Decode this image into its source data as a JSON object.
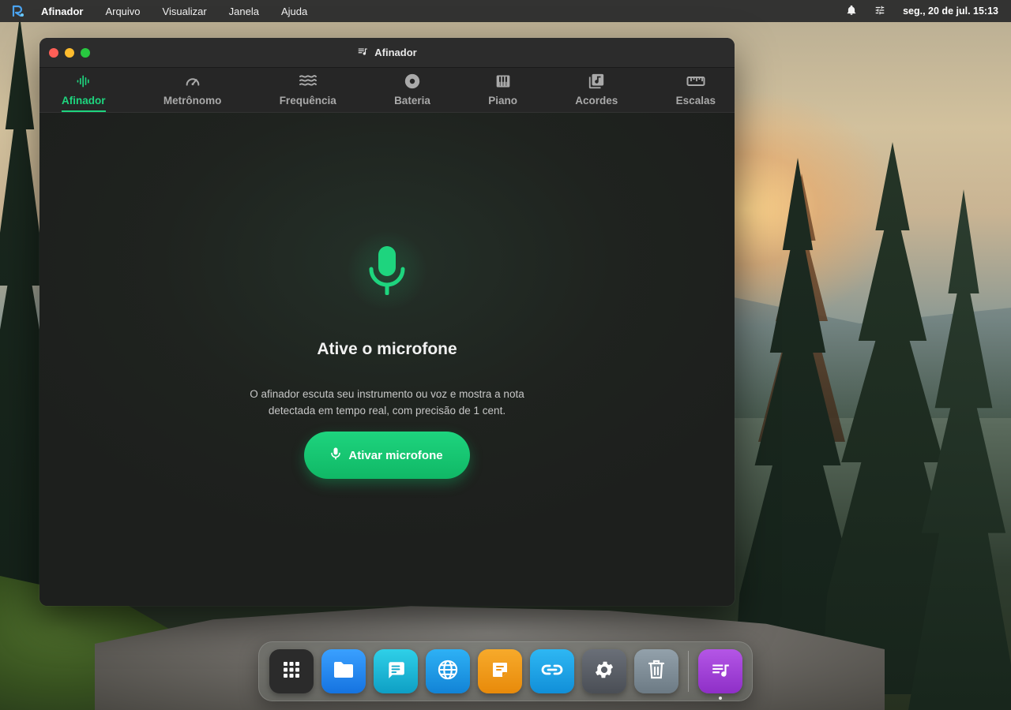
{
  "menubar": {
    "app_name": "Afinador",
    "menus": [
      "Arquivo",
      "Visualizar",
      "Janela",
      "Ajuda"
    ],
    "clock": "seg., 20 de jul. 15:13",
    "icons": [
      "app-logo-icon",
      "bell-icon",
      "sliders-icon"
    ]
  },
  "window": {
    "title": "Afinador",
    "tabs": [
      {
        "label": "Afinador",
        "icon": "waveform-icon",
        "active": true
      },
      {
        "label": "Metrônomo",
        "icon": "gauge-icon",
        "active": false
      },
      {
        "label": "Frequência",
        "icon": "waves-icon",
        "active": false
      },
      {
        "label": "Bateria",
        "icon": "disc-icon",
        "active": false
      },
      {
        "label": "Piano",
        "icon": "piano-icon",
        "active": false
      },
      {
        "label": "Acordes",
        "icon": "library-music-icon",
        "active": false
      },
      {
        "label": "Escalas",
        "icon": "ruler-icon",
        "active": false
      }
    ]
  },
  "main": {
    "heading": "Ative o microfone",
    "description": "O afinador escuta seu instrumento ou voz e mostra a nota detectada em tempo real, com precisão de 1 cent.",
    "button_label": "Ativar microfone"
  },
  "dock": {
    "items": [
      {
        "name": "launcher",
        "icon": "grid-icon",
        "color": "#2b2b2b"
      },
      {
        "name": "files",
        "icon": "folder-icon",
        "color": "#1f8ef1"
      },
      {
        "name": "messages",
        "icon": "chat-icon",
        "color": "#18b6d6"
      },
      {
        "name": "browser",
        "icon": "globe-icon",
        "color": "#1d9ce6"
      },
      {
        "name": "notes",
        "icon": "note-icon",
        "color": "#f29a13"
      },
      {
        "name": "links",
        "icon": "link-icon",
        "color": "#1aa6e8"
      },
      {
        "name": "settings",
        "icon": "gear-icon",
        "color": "#5b5f66"
      },
      {
        "name": "trash",
        "icon": "trash-icon",
        "color": "#7d8a94"
      },
      {
        "name": "afinador",
        "icon": "playlist-music-icon",
        "color": "#a33fd6",
        "running": true
      }
    ]
  },
  "colors": {
    "accent": "#1ed47e",
    "menubar": "#2e2e2e",
    "window_bg": "#1f211f"
  }
}
